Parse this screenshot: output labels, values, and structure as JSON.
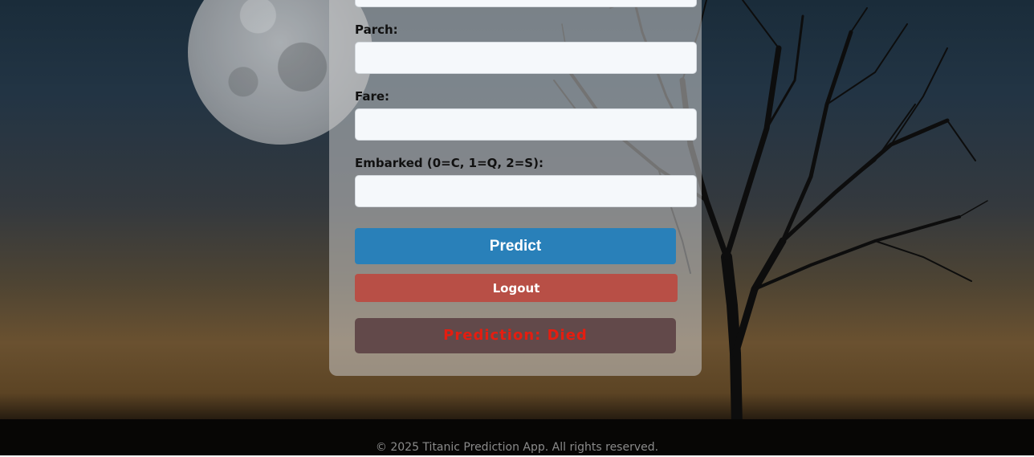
{
  "form": {
    "fields": [
      {
        "label": "Parch:",
        "value": "",
        "placeholder": ""
      },
      {
        "label": "Fare:",
        "value": "",
        "placeholder": ""
      },
      {
        "label": "Embarked (0=C, 1=Q, 2=S):",
        "value": "",
        "placeholder": ""
      }
    ],
    "predict_label": "Predict",
    "logout_label": "Logout"
  },
  "result": {
    "text": "Prediction: Died"
  },
  "footer": {
    "text": "© 2025 Titanic Prediction App. All rights reserved."
  },
  "colors": {
    "predict_button": "#2980b9",
    "logout_button": "#b84f46",
    "result_text": "#e51d10",
    "result_background": "#62494a"
  },
  "icons": [
    "moon-background",
    "tree-silhouette"
  ]
}
